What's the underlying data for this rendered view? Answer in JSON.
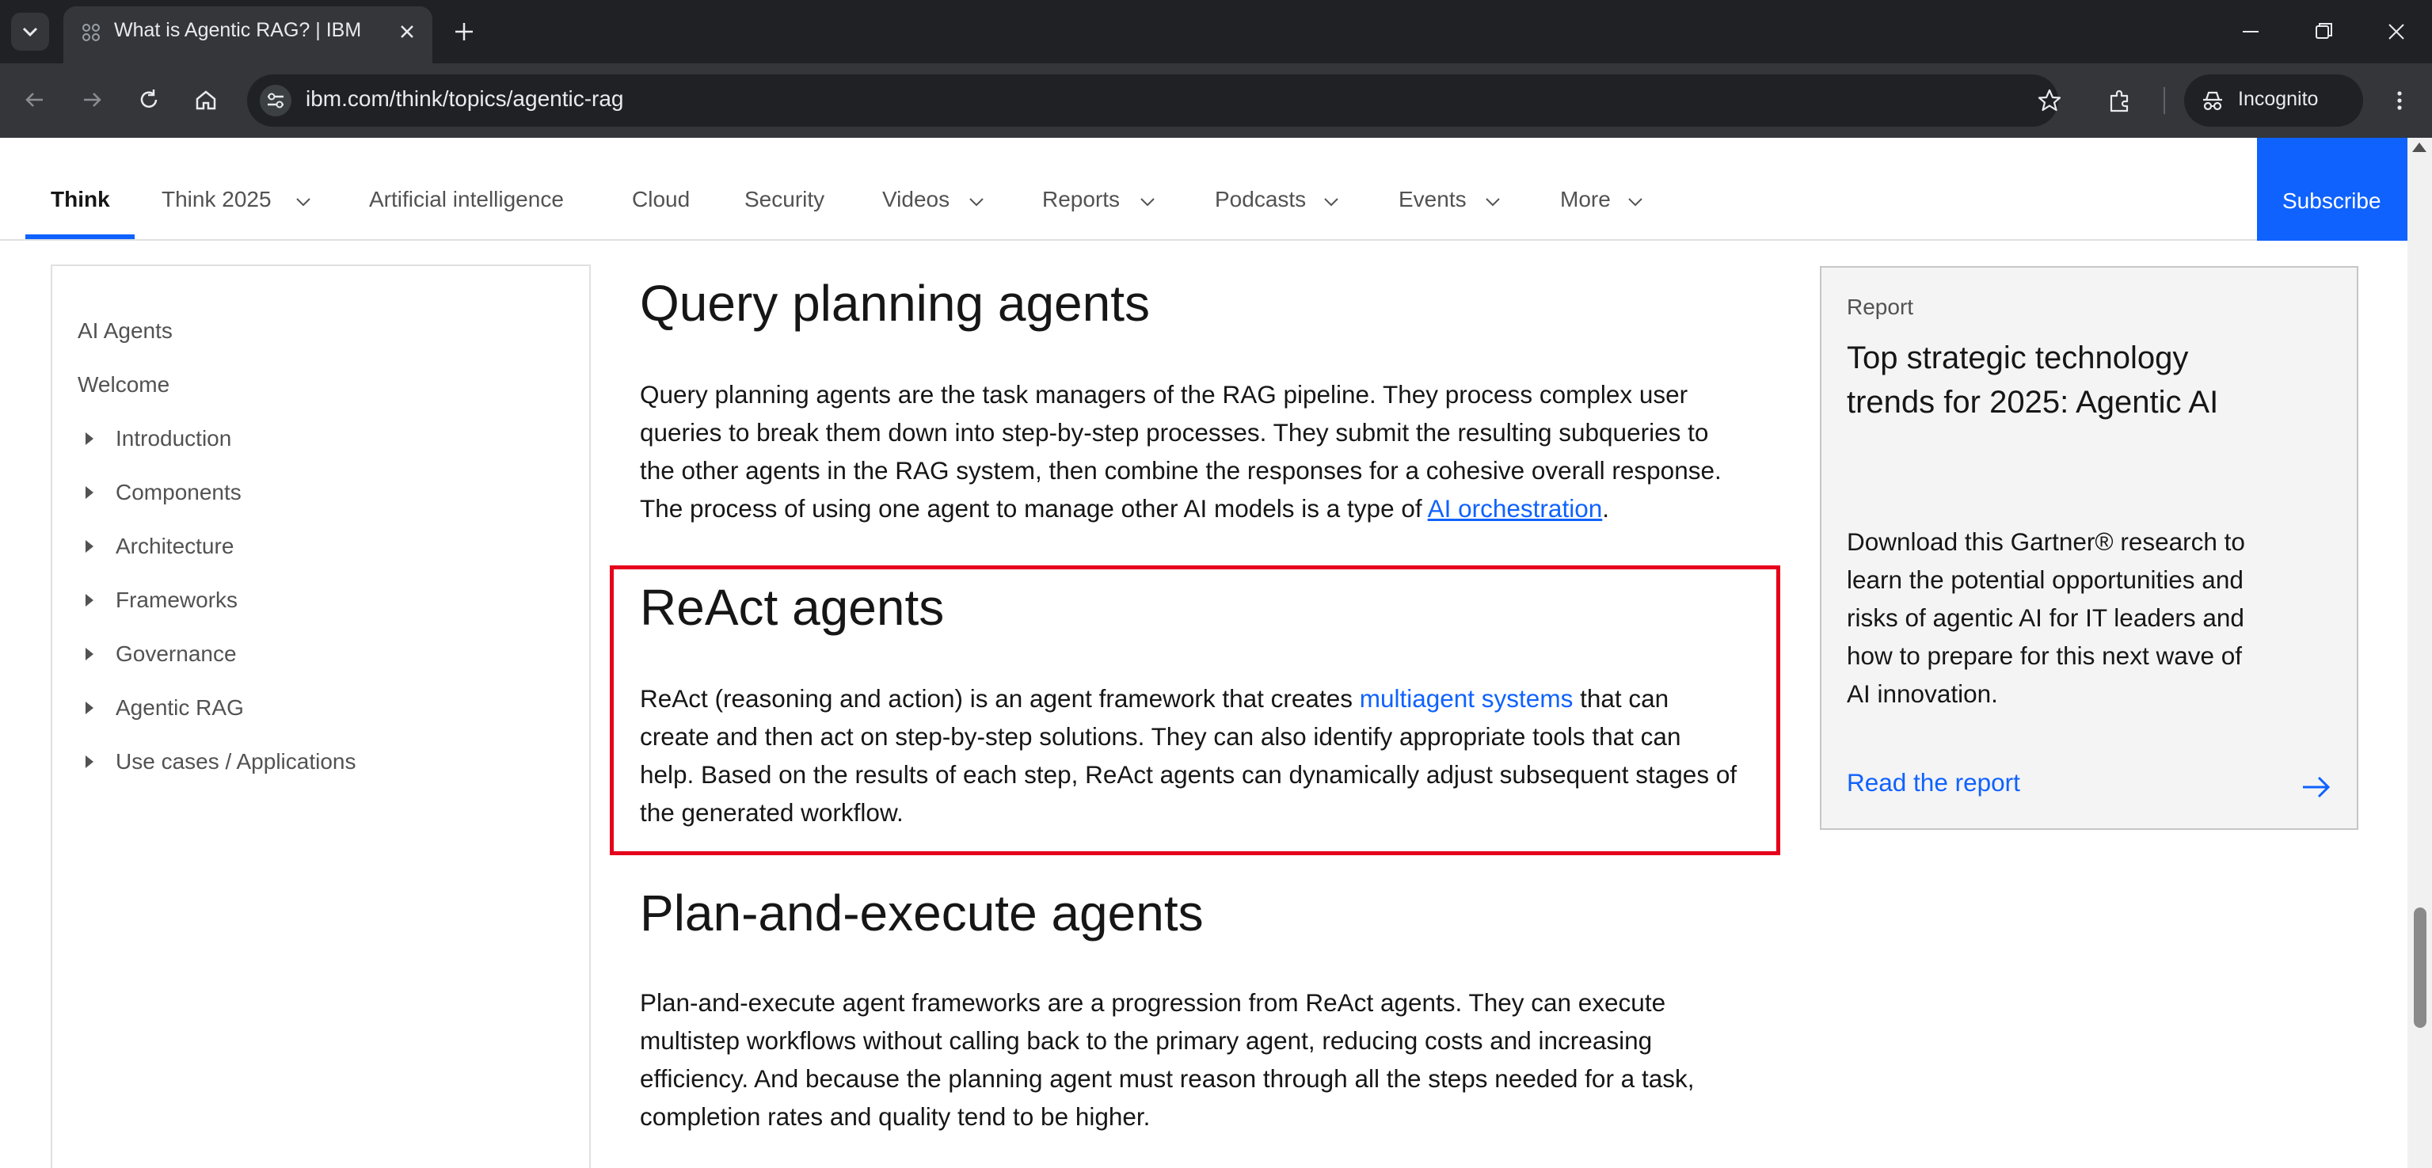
{
  "browser": {
    "tab_title": "What is Agentic RAG? | IBM",
    "url": "ibm.com/think/topics/agentic-rag",
    "incognito_label": "Incognito",
    "icons": [
      "tab-list-icon",
      "favicon-icon",
      "close-icon",
      "new-tab-icon",
      "minimize-icon",
      "restore-icon",
      "window-close-icon",
      "back-icon",
      "forward-icon",
      "reload-icon",
      "home-icon",
      "site-info-icon",
      "bookmark-star-icon",
      "extensions-icon",
      "incognito-icon",
      "kebab-menu-icon"
    ]
  },
  "nav": {
    "items": [
      "Think",
      "Think 2025",
      "Artificial intelligence",
      "Cloud",
      "Security",
      "Videos",
      "Reports",
      "Podcasts",
      "Events",
      "More"
    ],
    "active": "Think",
    "subscribe": "Subscribe",
    "brand_color": "#0f62fe"
  },
  "toc": {
    "items": [
      "AI Agents",
      "Welcome",
      "Introduction",
      "Components",
      "Architecture",
      "Frameworks",
      "Governance",
      "Agentic RAG",
      "Use cases / Applications"
    ]
  },
  "article": {
    "s1": {
      "heading": "Query planning agents",
      "l1": "Query planning agents are the task managers of the RAG pipeline. They process complex user",
      "l2": "queries to break them down into step-by-step processes. They submit the resulting subqueries to",
      "l3": "the other agents in the RAG system, then combine the responses for a cohesive overall response.",
      "l4_pre": "The process of using one agent to manage other AI models is a type of ",
      "l4_link": "AI orchestration",
      "l4_post": "."
    },
    "s2": {
      "heading": "ReAct agents",
      "l1_pre": "ReAct (reasoning and action) is an agent framework that creates ",
      "l1_link": "multiagent systems",
      "l1_post": " that can",
      "l2": "create and then act on step-by-step solutions. They can also identify appropriate tools that can",
      "l3": "help. Based on the results of each step, ReAct agents can dynamically adjust subsequent stages of",
      "l4": "the generated workflow.",
      "highlight_color": "#e5001b"
    },
    "s3": {
      "heading": "Plan-and-execute agents",
      "l1": "Plan-and-execute agent frameworks are a progression from ReAct agents. They can execute",
      "l2": "multistep workflows without calling back to the primary agent, reducing costs and increasing",
      "l3": "efficiency. And because the planning agent must reason through all the steps needed for a task,",
      "l4": "completion rates and quality tend to be higher."
    }
  },
  "card": {
    "eyebrow": "Report",
    "title_l1": "Top strategic technology",
    "title_l2": "trends for 2025: Agentic AI",
    "desc_l1": "Download this Gartner® research to",
    "desc_l2": "learn the potential opportunities and",
    "desc_l3": "risks of agentic AI for IT leaders and",
    "desc_l4": "how to prepare for this next wave of",
    "desc_l5": "AI innovation.",
    "cta": "Read the report"
  }
}
